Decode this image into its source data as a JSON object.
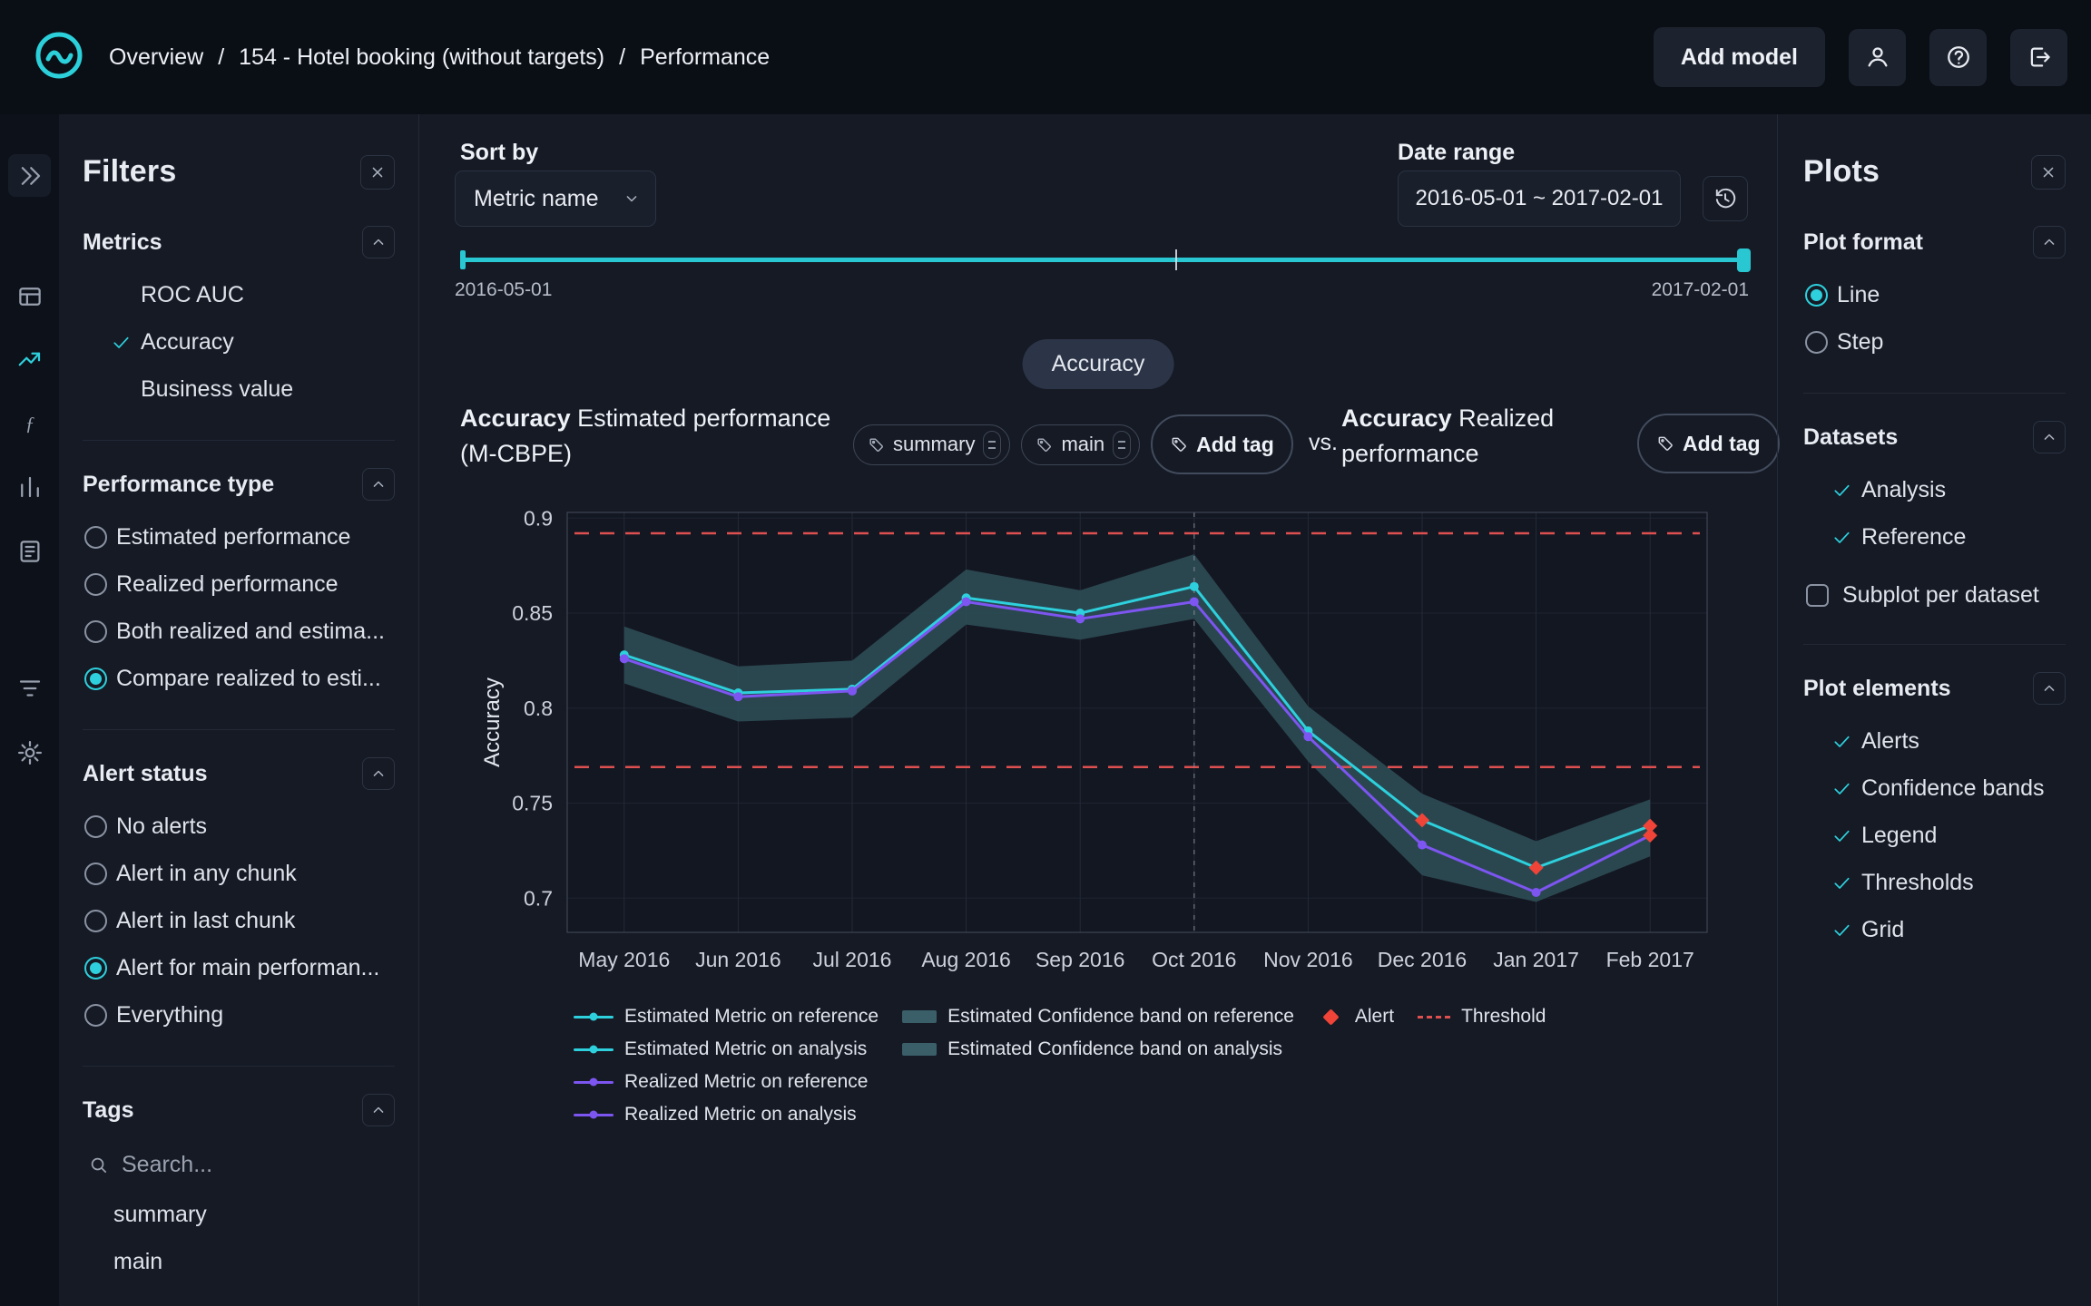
{
  "topbar": {
    "breadcrumb": [
      "Overview",
      "154 - Hotel booking (without targets)",
      "Performance"
    ],
    "separator": "/",
    "add_model_label": "Add model"
  },
  "rail": {
    "items": [
      {
        "name": "expand-sidebar",
        "icon": "chevrons-right",
        "active": false
      },
      {
        "name": "model-overview",
        "icon": "table",
        "active": false
      },
      {
        "name": "performance",
        "icon": "line-chart",
        "active": true
      },
      {
        "name": "concept-drift",
        "icon": "function",
        "active": false
      },
      {
        "name": "data-drift",
        "icon": "bar-chart",
        "active": false
      },
      {
        "name": "data-quality",
        "icon": "report",
        "active": false
      },
      {
        "name": "logs",
        "icon": "filter-lines",
        "active": false
      },
      {
        "name": "settings",
        "icon": "gear",
        "active": false
      }
    ]
  },
  "filters": {
    "title": "Filters",
    "metrics": {
      "title": "Metrics",
      "items": [
        {
          "label": "ROC AUC",
          "checked": false
        },
        {
          "label": "Accuracy",
          "checked": true
        },
        {
          "label": "Business value",
          "checked": false
        }
      ]
    },
    "performance_type": {
      "title": "Performance type",
      "options": [
        {
          "label": "Estimated performance",
          "selected": false
        },
        {
          "label": "Realized performance",
          "selected": false
        },
        {
          "label": "Both realized and estima...",
          "selected": false
        },
        {
          "label": "Compare realized to esti...",
          "selected": true
        }
      ]
    },
    "alert_status": {
      "title": "Alert status",
      "options": [
        {
          "label": "No alerts",
          "selected": false
        },
        {
          "label": "Alert in any chunk",
          "selected": false
        },
        {
          "label": "Alert in last chunk",
          "selected": false
        },
        {
          "label": "Alert for main performan...",
          "selected": true
        },
        {
          "label": "Everything",
          "selected": false
        }
      ]
    },
    "tags": {
      "title": "Tags",
      "search_placeholder": "Search...",
      "items": [
        "summary",
        "main"
      ]
    }
  },
  "toolbar": {
    "sort_by_label": "Sort by",
    "sort_value": "Metric name",
    "date_range_label": "Date range",
    "date_range_value": "2016-05-01 ~ 2017-02-01",
    "slider_start_label": "2016-05-01",
    "slider_end_label": "2017-02-01"
  },
  "metric_pill_label": "Accuracy",
  "chart_header": {
    "left_title_bold": "Accuracy",
    "left_title_rest": " Estimated performance (M-CBPE)",
    "tags": [
      "summary",
      "main"
    ],
    "add_tag_label": "Add tag",
    "vs_label": "vs.",
    "right_title_bold": "Accuracy",
    "right_title_rest": " Realized performance"
  },
  "chart_data": {
    "type": "line",
    "title": "Accuracy Estimated performance (M-CBPE) vs. Accuracy Realized performance",
    "ylabel": "Accuracy",
    "ylim": [
      0.682,
      0.903
    ],
    "yticks": [
      0.9,
      0.85,
      0.8,
      0.75,
      0.7
    ],
    "categories": [
      "May 2016",
      "Jun 2016",
      "Jul 2016",
      "Aug 2016",
      "Sep 2016",
      "Oct 2016",
      "Nov 2016",
      "Dec 2016",
      "Jan 2017",
      "Feb 2017"
    ],
    "reference_end_index": 5,
    "series": [
      {
        "name": "Estimated Metric",
        "color": "#2dd0dc",
        "values": [
          0.828,
          0.808,
          0.81,
          0.858,
          0.85,
          0.864,
          0.788,
          0.741,
          0.716,
          0.738
        ]
      },
      {
        "name": "Realized Metric",
        "color": "#7d55f0",
        "values": [
          0.826,
          0.806,
          0.809,
          0.856,
          0.847,
          0.856,
          0.785,
          0.728,
          0.703,
          0.733
        ]
      }
    ],
    "confidence_band": {
      "name": "Estimated Confidence band",
      "color": "#2d4c55",
      "upper": [
        0.843,
        0.822,
        0.825,
        0.873,
        0.862,
        0.881,
        0.801,
        0.755,
        0.73,
        0.752
      ],
      "lower": [
        0.813,
        0.793,
        0.795,
        0.844,
        0.836,
        0.847,
        0.772,
        0.712,
        0.698,
        0.722
      ]
    },
    "thresholds": {
      "upper": 0.892,
      "lower": 0.769,
      "color": "#de5050"
    },
    "alerts": [
      {
        "series": "Estimated Metric",
        "category": "Dec 2016",
        "value": 0.741
      },
      {
        "series": "Estimated Metric",
        "category": "Jan 2017",
        "value": 0.716
      },
      {
        "series": "Estimated Metric",
        "category": "Feb 2017",
        "value": 0.738
      },
      {
        "series": "Realized Metric",
        "category": "Feb 2017",
        "value": 0.733
      }
    ],
    "alert_color": "#f04438",
    "grid": true,
    "legend_position": "bottom",
    "legend": [
      {
        "label": "Estimated Metric on reference",
        "swatch": "line-dot",
        "color": "#2dd0dc",
        "col": 1,
        "row": 1
      },
      {
        "label": "Estimated Metric on analysis",
        "swatch": "line-dot",
        "color": "#2dd0dc",
        "col": 1,
        "row": 2
      },
      {
        "label": "Realized Metric on reference",
        "swatch": "line-dot",
        "color": "#7d55f0",
        "col": 1,
        "row": 3
      },
      {
        "label": "Realized Metric on analysis",
        "swatch": "line-dot",
        "color": "#7d55f0",
        "col": 1,
        "row": 4
      },
      {
        "label": "Estimated Confidence band on reference",
        "swatch": "band",
        "color": "#3a5f69",
        "col": 2,
        "row": 1
      },
      {
        "label": "Estimated Confidence band on analysis",
        "swatch": "band",
        "color": "#3a5f69",
        "col": 2,
        "row": 2
      },
      {
        "label": "Alert",
        "swatch": "diamond",
        "color": "#f04438",
        "col": 3,
        "row": 1
      },
      {
        "label": "Threshold",
        "swatch": "dash",
        "color": "#de5050",
        "col": 4,
        "row": 1
      }
    ]
  },
  "plots_panel": {
    "title": "Plots",
    "plot_format": {
      "title": "Plot format",
      "options": [
        {
          "label": "Line",
          "selected": true
        },
        {
          "label": "Step",
          "selected": false
        }
      ]
    },
    "datasets": {
      "title": "Datasets",
      "items": [
        {
          "label": "Analysis",
          "checked": true
        },
        {
          "label": "Reference",
          "checked": true
        }
      ],
      "subplot": {
        "label": "Subplot per dataset",
        "checked": false
      }
    },
    "plot_elements": {
      "title": "Plot elements",
      "items": [
        {
          "label": "Alerts",
          "checked": true
        },
        {
          "label": "Confidence bands",
          "checked": true
        },
        {
          "label": "Legend",
          "checked": true
        },
        {
          "label": "Thresholds",
          "checked": true
        },
        {
          "label": "Grid",
          "checked": true
        }
      ]
    }
  },
  "colors": {
    "accent_teal": "#2dd0dc",
    "purple": "#7d55f0",
    "alert_red": "#f04438",
    "threshold_red": "#de5050",
    "band": "#2d4c55"
  }
}
